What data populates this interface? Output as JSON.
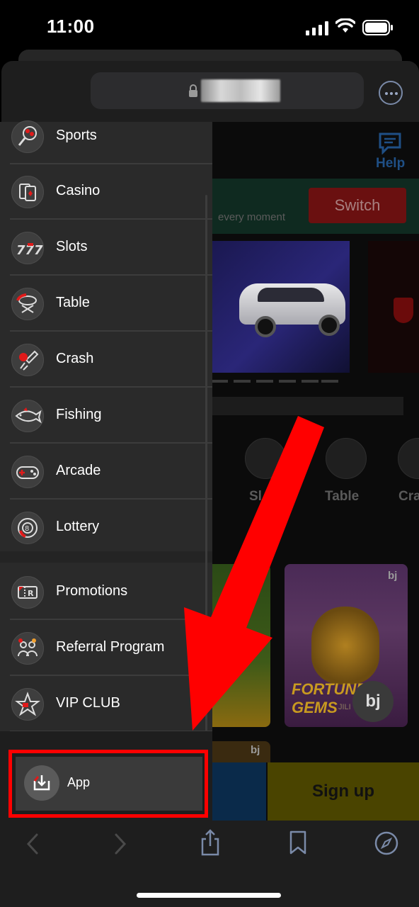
{
  "status_bar": {
    "time": "11:00"
  },
  "browser": {
    "url_redacted": true
  },
  "page_bg": {
    "help_label": "Help",
    "promo_text": "every moment",
    "switch_label": "Switch",
    "categories": [
      {
        "label": "Sl"
      },
      {
        "label": "Table"
      },
      {
        "label": "Cra"
      }
    ],
    "tiles": {
      "bj": "bj",
      "fortune_title": "FORTUNE GEMS",
      "fortune_sub": "JILI",
      "bj_circle": "bj"
    },
    "signup_label": "Sign up"
  },
  "menu": {
    "items": [
      {
        "label": "Sports",
        "icon": "sports-icon"
      },
      {
        "label": "Casino",
        "icon": "casino-icon"
      },
      {
        "label": "Slots",
        "icon": "slots-icon"
      },
      {
        "label": "Table",
        "icon": "table-icon"
      },
      {
        "label": "Crash",
        "icon": "crash-icon"
      },
      {
        "label": "Fishing",
        "icon": "fishing-icon"
      },
      {
        "label": "Arcade",
        "icon": "arcade-icon"
      },
      {
        "label": "Lottery",
        "icon": "lottery-icon"
      }
    ],
    "extras": [
      {
        "label": "Promotions",
        "icon": "promotions-icon"
      },
      {
        "label": "Referral Program",
        "icon": "referral-icon"
      },
      {
        "label": "VIP CLUB",
        "icon": "vip-icon"
      }
    ],
    "app_label": "App"
  },
  "colors": {
    "highlight": "#ff0000",
    "menu_bg": "#2a2a2a"
  }
}
